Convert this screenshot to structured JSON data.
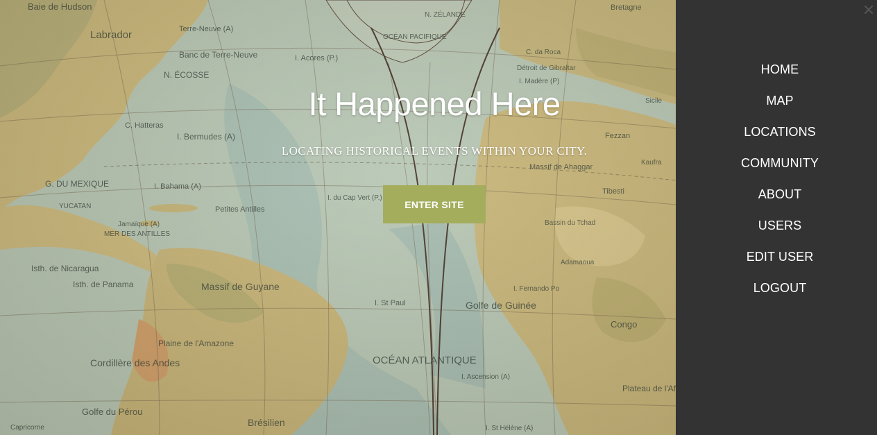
{
  "hero": {
    "title": "It Happened Here",
    "subtitle": "LOCATING HISTORICAL EVENTS WITHIN YOUR CITY.",
    "cta_label": "ENTER SITE"
  },
  "map": {
    "labels": [
      {
        "text": "Baie de Hudson"
      },
      {
        "text": "Labrador"
      },
      {
        "text": "Terre-Neuve (A)"
      },
      {
        "text": "Banc de Terre-Neuve"
      },
      {
        "text": "N. ÉCOSSE"
      },
      {
        "text": "I. Bermudes (A)"
      },
      {
        "text": "C. Hatteras"
      },
      {
        "text": "G. DU MEXIQUE"
      },
      {
        "text": "YUCATAN"
      },
      {
        "text": "I. Bahama (A)"
      },
      {
        "text": "Jamaïque (A)"
      },
      {
        "text": "MER DES ANTILLES"
      },
      {
        "text": "Petites Antilles"
      },
      {
        "text": "Isth. de Panama"
      },
      {
        "text": "Isth. de Nicaragua"
      },
      {
        "text": "Massif de Guyane"
      },
      {
        "text": "Cordillère des Andes"
      },
      {
        "text": "Golfe du Pérou"
      },
      {
        "text": "Plaine de l'Amazone"
      },
      {
        "text": "Brésilien"
      },
      {
        "text": "OCÉAN ATLANTIQUE"
      },
      {
        "text": "Golfe de Guinée"
      },
      {
        "text": "I. Acores (P.)"
      },
      {
        "text": "I. du Cap Vert (P.)"
      },
      {
        "text": "I. St Paul"
      },
      {
        "text": "Massif de Ahaggar"
      },
      {
        "text": "Congo"
      },
      {
        "text": "Tibesti"
      },
      {
        "text": "OCÉAN PACIFIQUE"
      },
      {
        "text": "N. ZÉLANDE"
      },
      {
        "text": "Bretagne"
      },
      {
        "text": "I. Madère (P)"
      },
      {
        "text": "C. da Roca"
      },
      {
        "text": "Détroit de Gibraltar"
      },
      {
        "text": "Bassin du Tchad"
      },
      {
        "text": "I. Fernando Po"
      },
      {
        "text": "I. Ascension (A)"
      },
      {
        "text": "I. St Hélène (A)"
      },
      {
        "text": "Capricorne"
      },
      {
        "text": "Sicile"
      },
      {
        "text": "Fezzan"
      },
      {
        "text": "Kaufra"
      },
      {
        "text": "Adamaoua"
      },
      {
        "text": "Plateau de l'Afrique Austra"
      }
    ]
  },
  "menu": {
    "items": [
      {
        "label": "HOME"
      },
      {
        "label": "MAP"
      },
      {
        "label": "LOCATIONS"
      },
      {
        "label": "COMMUNITY"
      },
      {
        "label": "ABOUT"
      },
      {
        "label": "USERS"
      },
      {
        "label": "EDIT USER"
      },
      {
        "label": "LOGOUT"
      }
    ],
    "close_icon": "close-icon"
  },
  "colors": {
    "sidebar_bg": "#333333",
    "button_bg": "#a4ad5c",
    "ocean": "#b7c7b4",
    "land": "#c9b57a"
  }
}
